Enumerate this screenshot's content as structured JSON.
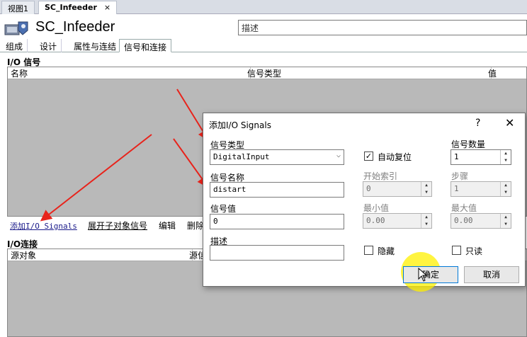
{
  "doc_tabs": [
    {
      "label": "视图1"
    },
    {
      "label": "SC_Infeeder",
      "close": "×"
    }
  ],
  "header": {
    "title": "SC_Infeeder",
    "description_placeholder": "描述"
  },
  "sub_tabs": [
    "组成",
    "设计",
    "属性与连结",
    "信号和连接"
  ],
  "io_signals": {
    "label": "I/O 信号",
    "columns": [
      "名称",
      "信号类型",
      "值"
    ],
    "actions": [
      "添加I/O Signals",
      "展开子对象信号",
      "编辑",
      "删除"
    ]
  },
  "io_connections": {
    "label": "I/O连接",
    "columns": [
      "源对象",
      "源信"
    ]
  },
  "dialog": {
    "title": "添加I/O Signals",
    "help": "?",
    "close": "✕",
    "signal_type_label": "信号类型",
    "signal_type_value": "DigitalInput",
    "signal_name_label": "信号名称",
    "signal_name_value": "distart",
    "signal_value_label": "信号值",
    "signal_value_value": "0",
    "desc_label": "描述",
    "desc_value": "",
    "auto_reset_label": "自动复位",
    "auto_reset_checked": true,
    "start_index_label": "开始索引",
    "start_index_value": "0",
    "min_label": "最小值",
    "min_value": "0.00",
    "hidden_label": "隐藏",
    "hidden_checked": false,
    "count_label": "信号数量",
    "count_value": "1",
    "step_label": "步骤",
    "step_value": "1",
    "max_label": "最大值",
    "max_value": "0.00",
    "readonly_label": "只读",
    "readonly_checked": false,
    "ok_label": "确定",
    "cancel_label": "取消"
  },
  "colors": {
    "grid_bg": "#b9b9b9",
    "arrow": "#e8231b",
    "cursor_highlight": "#fff000",
    "primary_border": "#0078d7"
  }
}
